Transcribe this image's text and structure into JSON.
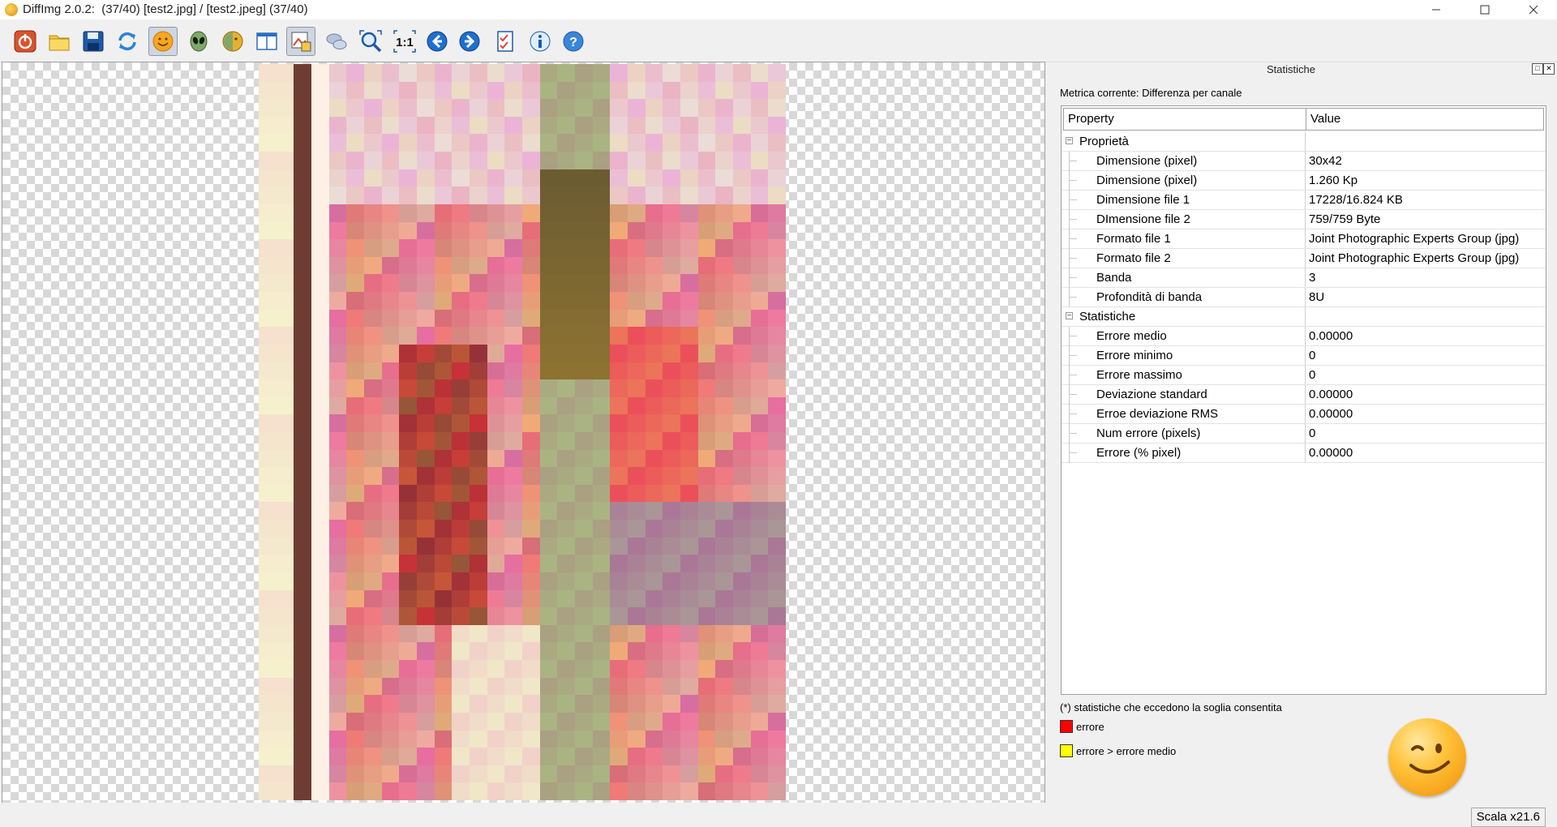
{
  "window": {
    "title": "DiffImg 2.0.2:  (37/40) [test2.jpg] / [test2.jpeg] (37/40)"
  },
  "toolbar": {
    "buttons": [
      {
        "name": "quit-icon",
        "active": false
      },
      {
        "name": "open-folder-icon",
        "active": false
      },
      {
        "name": "save-icon",
        "active": false
      },
      {
        "name": "refresh-icon",
        "active": false
      },
      {
        "name": "smiley-icon",
        "active": true
      },
      {
        "name": "alien-icon",
        "active": false
      },
      {
        "name": "color-smiley-icon",
        "active": false
      },
      {
        "name": "dual-panel-icon",
        "active": false
      },
      {
        "name": "difference-image-icon",
        "active": true
      },
      {
        "name": "chat-icon",
        "active": false
      },
      {
        "name": "zoom-fit-icon",
        "active": false
      },
      {
        "name": "zoom-one-to-one-icon",
        "active": false
      },
      {
        "name": "previous-arrow-icon",
        "active": false
      },
      {
        "name": "next-arrow-icon",
        "active": false
      },
      {
        "name": "checklist-icon",
        "active": false
      },
      {
        "name": "info-icon",
        "active": false
      },
      {
        "name": "help-icon",
        "active": false
      }
    ],
    "one_to_one_label": "1:1"
  },
  "panel": {
    "title": "Statistiche",
    "metric_label": "Metrica corrente: Differenza per canale",
    "table": {
      "headers": [
        "Property",
        "Value"
      ],
      "groups": [
        {
          "label": "Proprietà",
          "rows": [
            {
              "prop": "Dimensione (pixel)",
              "value": "30x42"
            },
            {
              "prop": "Dimensione (pixel)",
              "value": "1.260 Kp"
            },
            {
              "prop": "Dimensione file 1",
              "value": "17228/16.824 KB"
            },
            {
              "prop": "DImensione file 2",
              "value": "759/759 Byte"
            },
            {
              "prop": "Formato file 1",
              "value": "Joint Photographic Experts Group (jpg)"
            },
            {
              "prop": "Formato file 2",
              "value": "Joint Photographic Experts Group (jpg)"
            },
            {
              "prop": "Banda",
              "value": "3"
            },
            {
              "prop": "Profondità di banda",
              "value": "8U"
            }
          ]
        },
        {
          "label": "Statistiche",
          "rows": [
            {
              "prop": "Errore medio",
              "value": "0.00000"
            },
            {
              "prop": "Errore minimo",
              "value": "0"
            },
            {
              "prop": "Errore massimo",
              "value": "0"
            },
            {
              "prop": "Deviazione standard",
              "value": "0.00000"
            },
            {
              "prop": "Erroe deviazione RMS",
              "value": "0.00000"
            },
            {
              "prop": "Num errore (pixels)",
              "value": "0"
            },
            {
              "prop": "Errore (% pixel)",
              "value": "0.00000"
            }
          ]
        }
      ]
    },
    "legend": {
      "note": "(*) statistiche che eccedono la soglia consentita",
      "items": [
        {
          "label": "errore",
          "color": "#ff0000"
        },
        {
          "label": "errore > errore medio",
          "color": "#ffff00"
        }
      ]
    }
  },
  "status": {
    "zoom": "Scala x21.6"
  },
  "colors": {
    "image_palette_note": "pixelated pink/red/green photo rendered from 30x42 pixels"
  }
}
